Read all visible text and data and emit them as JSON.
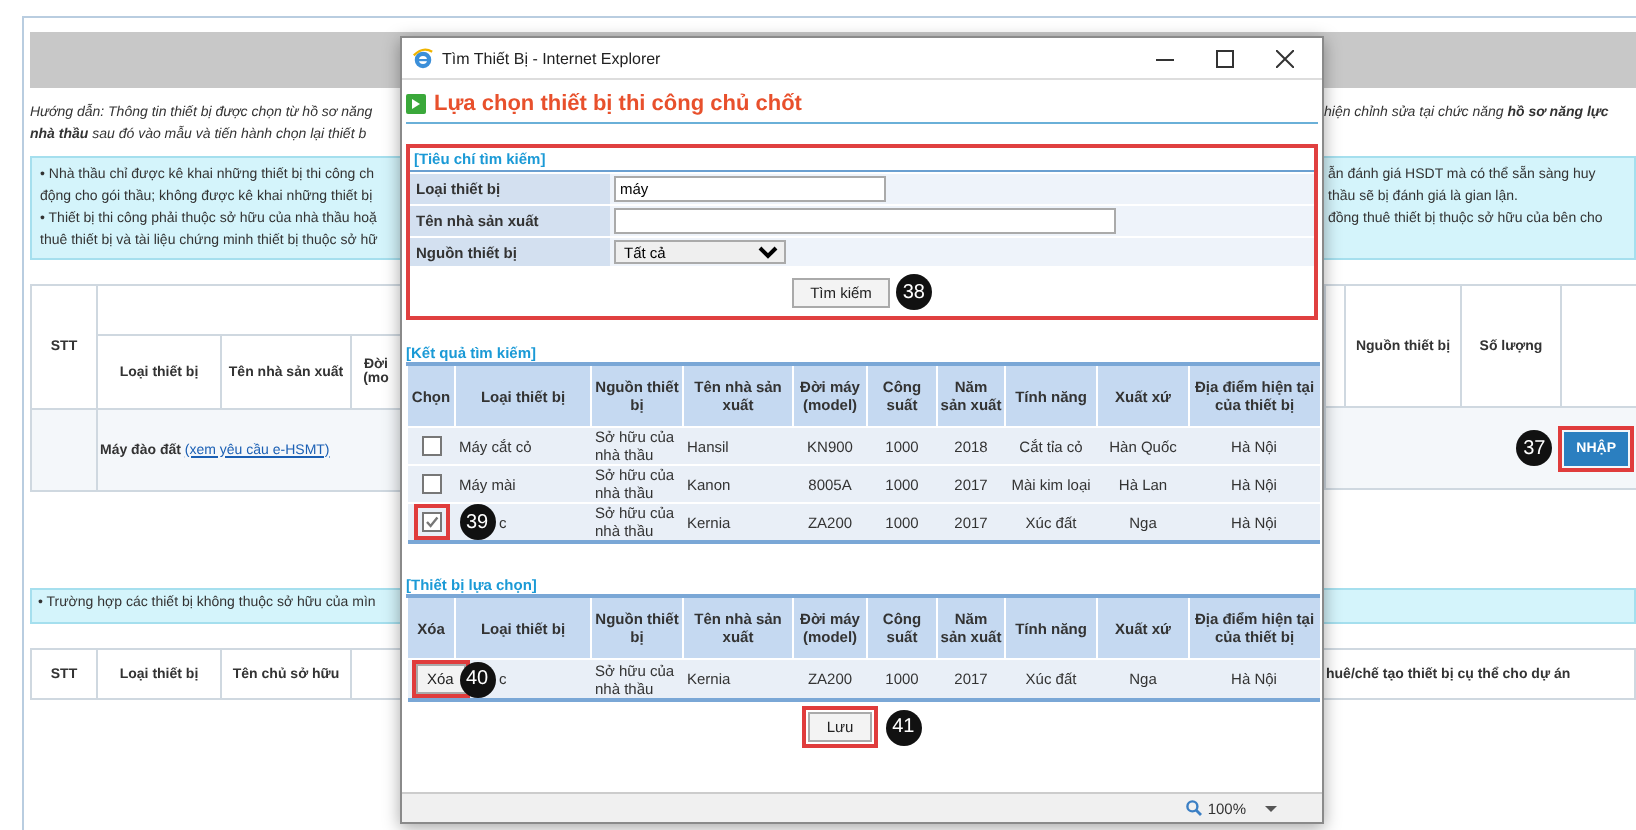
{
  "background_page": {
    "guidance": {
      "left_lines": [
        "Hướng dẫn: Thông tin thiết bị được chọn từ hồ sơ năng",
        "**nhà thầu** sau đó vào mẫu và tiến hành chọn lại thiết b"
      ],
      "right_lines": [
        "hiện chỉnh sửa tại chức năng **hồ sơ năng lực**"
      ]
    },
    "notice": {
      "left_lines": [
        "• Nhà thầu chỉ được kê khai những thiết bị thi công ch",
        "động cho gói thầu; không được kê khai những thiết bị",
        "• Thiết bị thi công phải thuộc sở hữu của nhà thầu hoặ",
        "thuê thiết bị và tài liệu chứng minh thiết bị thuộc sở hữ"
      ],
      "right_lines": [
        "ẫn đánh giá HSDT mà có thể sẵn sàng huy",
        "thầu sẽ bị đánh giá là gian lận.",
        "đồng thuê thiết bị thuộc sở hữu của bên cho"
      ]
    },
    "equipment_table": {
      "left_columns": [
        "STT",
        "Loại thiết bị",
        "Tên nhà sản xuất",
        "Đời (mo"
      ],
      "right_columns": [
        "Nguồn thiết bị",
        "Số lượng"
      ],
      "row": {
        "name": "Máy đào đất",
        "link": "(xem yêu cầu e-HSMT)",
        "badge": "37",
        "button": "NHẬP"
      }
    },
    "notice2": {
      "left_text": "• Trường hợp các thiết bị không thuộc sở hữu của mìn"
    },
    "owner_table": {
      "left_columns": [
        "STT",
        "Loại thiết bị",
        "Tên chủ sở hữu"
      ],
      "right_text": "huê/chế tạo thiết bị cụ thể cho dự án"
    }
  },
  "popup": {
    "title": "Tìm Thiết Bị - Internet Explorer",
    "heading": "Lựa chọn thiết bị thi công chủ chốt",
    "search": {
      "legend": "[Tiêu chí tìm kiếm]",
      "fields": [
        {
          "label": "Loại thiết bị",
          "kind": "text",
          "value": "máy"
        },
        {
          "label": "Tên nhà sản xuất",
          "kind": "text"
        },
        {
          "label": "Nguồn thiết bị",
          "kind": "select",
          "value": "Tất cả"
        }
      ],
      "button": "Tìm kiếm",
      "badge": "38"
    },
    "results": {
      "legend": "[Kết quả tìm kiếm]",
      "columns": [
        "Chọn",
        "Loại thiết bị",
        "Nguồn thiết bị",
        "Tên nhà sản xuất",
        "Đời máy (model)",
        "Công suất",
        "Năm sản xuất",
        "Tính năng",
        "Xuất xứ",
        "Địa điểm hiện tại của thiết bị"
      ],
      "rows": [
        {
          "checked": false,
          "type": "Máy cắt cỏ",
          "source": "Sở hữu của nhà thầu",
          "maker": "Hansil",
          "model": "KN900",
          "power": "1000",
          "year": "2018",
          "feature": "Cắt tỉa cỏ",
          "origin": "Hàn Quốc",
          "location": "Hà Nội"
        },
        {
          "checked": false,
          "type": "Máy mài",
          "source": "Sở hữu của nhà thầu",
          "maker": "Kanon",
          "model": "8005A",
          "power": "1000",
          "year": "2017",
          "feature": "Mài kim loại",
          "origin": "Hà Lan",
          "location": "Hà Nội"
        },
        {
          "checked": true,
          "badge": "39",
          "type": "c",
          "source": "Sở hữu của nhà thầu",
          "maker": "Kernia",
          "model": "ZA200",
          "power": "1000",
          "year": "2017",
          "feature": "Xúc đất",
          "origin": "Nga",
          "location": "Hà Nội"
        }
      ]
    },
    "chosen": {
      "legend": "[Thiết bị lựa chọn]",
      "columns": [
        "Xóa",
        "Loại thiết bị",
        "Nguồn thiết bị",
        "Tên nhà sản xuất",
        "Đời máy (model)",
        "Công suất",
        "Năm sản xuất",
        "Tính năng",
        "Xuất xứ",
        "Địa điểm hiện tại của thiết bị"
      ],
      "rows": [
        {
          "action": "Xóa",
          "badge": "40",
          "type": "c",
          "source": "Sở hữu của nhà thầu",
          "maker": "Kernia",
          "model": "ZA200",
          "power": "1000",
          "year": "2017",
          "feature": "Xúc đất",
          "origin": "Nga",
          "location": "Hà Nội"
        }
      ],
      "button": "Lưu",
      "badge": "41"
    },
    "status": {
      "zoom": "100%"
    }
  }
}
